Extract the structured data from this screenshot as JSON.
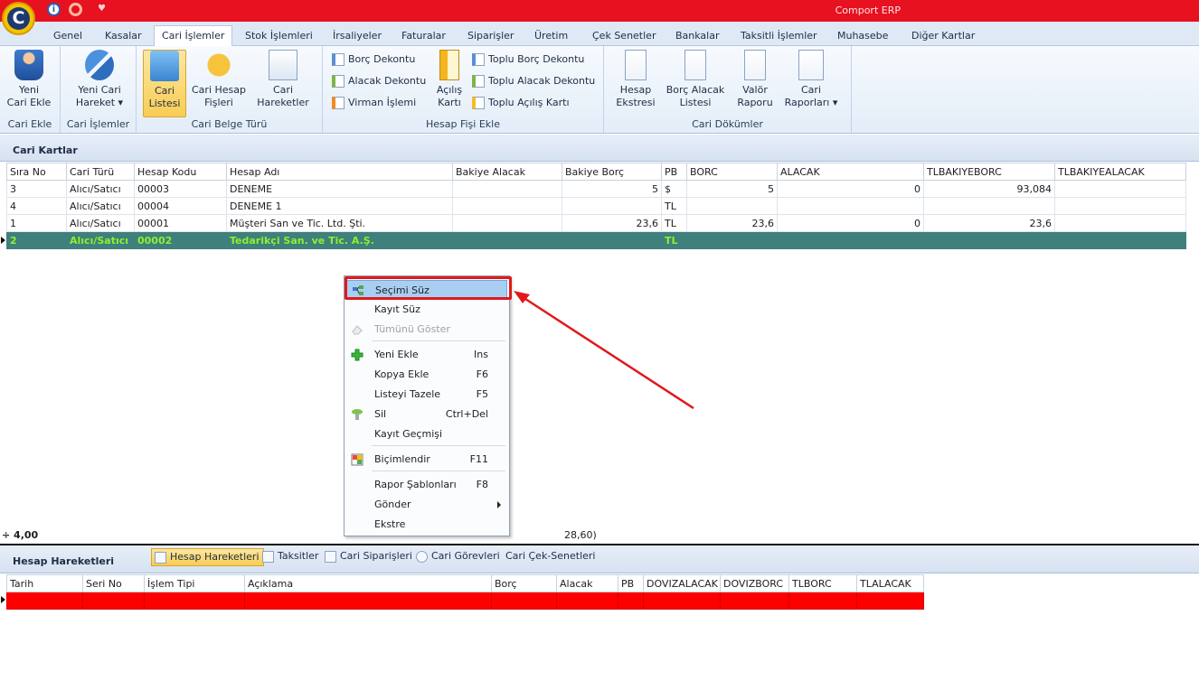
{
  "app": {
    "title": "Comport ERP",
    "logo_letter": "C"
  },
  "tabs": [
    "Genel",
    "Kasalar",
    "Cari İşlemler",
    "Stok İşlemleri",
    "İrsaliyeler",
    "Faturalar",
    "Siparişler",
    "Üretim",
    "Çek Senetler",
    "Bankalar",
    "Taksitli İşlemler",
    "Muhasebe",
    "Diğer Kartlar"
  ],
  "ribbon": {
    "cari_ekle": {
      "button": "Yeni Cari Ekle",
      "line1": "Yeni",
      "line2": "Cari Ekle",
      "group": "Cari Ekle"
    },
    "cari_islemler": {
      "line1": "Yeni Cari",
      "line2": "Hareket",
      "group": "Cari İşlemler"
    },
    "cari_belge": {
      "listesi_1": "Cari",
      "listesi_2": "Listesi",
      "hesap_1": "Cari Hesap",
      "hesap_2": "Fişleri",
      "hareket_1": "Cari",
      "hareket_2": "Hareketler",
      "group": "Cari Belge Türü"
    },
    "hesap_fisi": {
      "borc_dekontu": "Borç Dekontu",
      "alacak_dekontu": "Alacak Dekontu",
      "virman": "Virman İşlemi",
      "acilis_1": "Açılış",
      "acilis_2": "Kartı",
      "toplu_borc": "Toplu Borç Dekontu",
      "toplu_alacak": "Toplu Alacak Dekontu",
      "toplu_acilis": "Toplu Açılış Kartı",
      "group": "Hesap Fişi Ekle"
    },
    "cari_dokumler": {
      "ekstre_1": "Hesap",
      "ekstre_2": "Ekstresi",
      "borc_alacak_1": "Borç Alacak",
      "borc_alacak_2": "Listesi",
      "valor_1": "Valör",
      "valor_2": "Raporu",
      "raporlar_1": "Cari",
      "raporlar_2": "Raporları",
      "group": "Cari Dökümler"
    }
  },
  "cari_kartlar": {
    "title": "Cari Kartlar",
    "columns": [
      "Sıra No",
      "Cari Türü",
      "Hesap Kodu",
      "Hesap Adı",
      "Bakiye Alacak",
      "Bakiye Borç",
      "PB",
      "BORC",
      "ALACAK",
      "TLBAKIYEBORC",
      "TLBAKIYEALACAK"
    ],
    "rows": [
      [
        "3",
        "Alıcı/Satıcı",
        "00003",
        "DENEME",
        "",
        "5",
        "$",
        "5",
        "0",
        "93,084",
        ""
      ],
      [
        "4",
        "Alıcı/Satıcı",
        "00004",
        "DENEME 1",
        "",
        "",
        "TL",
        "",
        "",
        "",
        ""
      ],
      [
        "1",
        "Alıcı/Satıcı",
        "00001",
        "Müşteri San ve Tic. Ltd. Şti.",
        "",
        "23,6",
        "TL",
        "23,6",
        "0",
        "23,6",
        ""
      ],
      [
        "2",
        "Alıcı/Satıcı",
        "00002",
        "Tedarikçi San. ve Tic. A.Ş.",
        "",
        "",
        "TL",
        "",
        "",
        "",
        ""
      ]
    ],
    "footer_count": "4,00",
    "footer_total": "28,60"
  },
  "context_menu": {
    "items": [
      {
        "label": "Seçimi Süz",
        "shortcut": ""
      },
      {
        "label": "Kayıt Süz",
        "shortcut": ""
      },
      {
        "label": "Tümünü Göster",
        "shortcut": ""
      },
      {
        "label": "Yeni Ekle",
        "shortcut": "Ins"
      },
      {
        "label": "Kopya Ekle",
        "shortcut": "F6"
      },
      {
        "label": "Listeyi Tazele",
        "shortcut": "F5"
      },
      {
        "label": "Sil",
        "shortcut": "Ctrl+Del"
      },
      {
        "label": "Kayıt Geçmişi",
        "shortcut": ""
      },
      {
        "label": "Biçimlendir",
        "shortcut": "F11"
      },
      {
        "label": "Rapor Şablonları",
        "shortcut": "F8"
      },
      {
        "label": "Gönder",
        "shortcut": ""
      },
      {
        "label": "Ekstre",
        "shortcut": ""
      }
    ]
  },
  "hesap_hareketleri": {
    "title": "Hesap Hareketleri",
    "tabs": [
      "Hesap Hareketleri",
      "Taksitler",
      "Cari Siparişleri",
      "Cari Görevleri",
      "Cari Çek-Senetleri"
    ],
    "columns": [
      "Tarih",
      "Seri No",
      "İşlem Tipi",
      "Açıklama",
      "Borç",
      "Alacak",
      "PB",
      "DOVIZALACAK",
      "DOVIZBORC",
      "TLBORC",
      "TLALACAK"
    ]
  },
  "colors": {
    "title_bar": "#e8111f",
    "selected_row": "#3f7f7c",
    "selected_row_text": "#8af22e",
    "highlight_box": "#e0191d"
  }
}
